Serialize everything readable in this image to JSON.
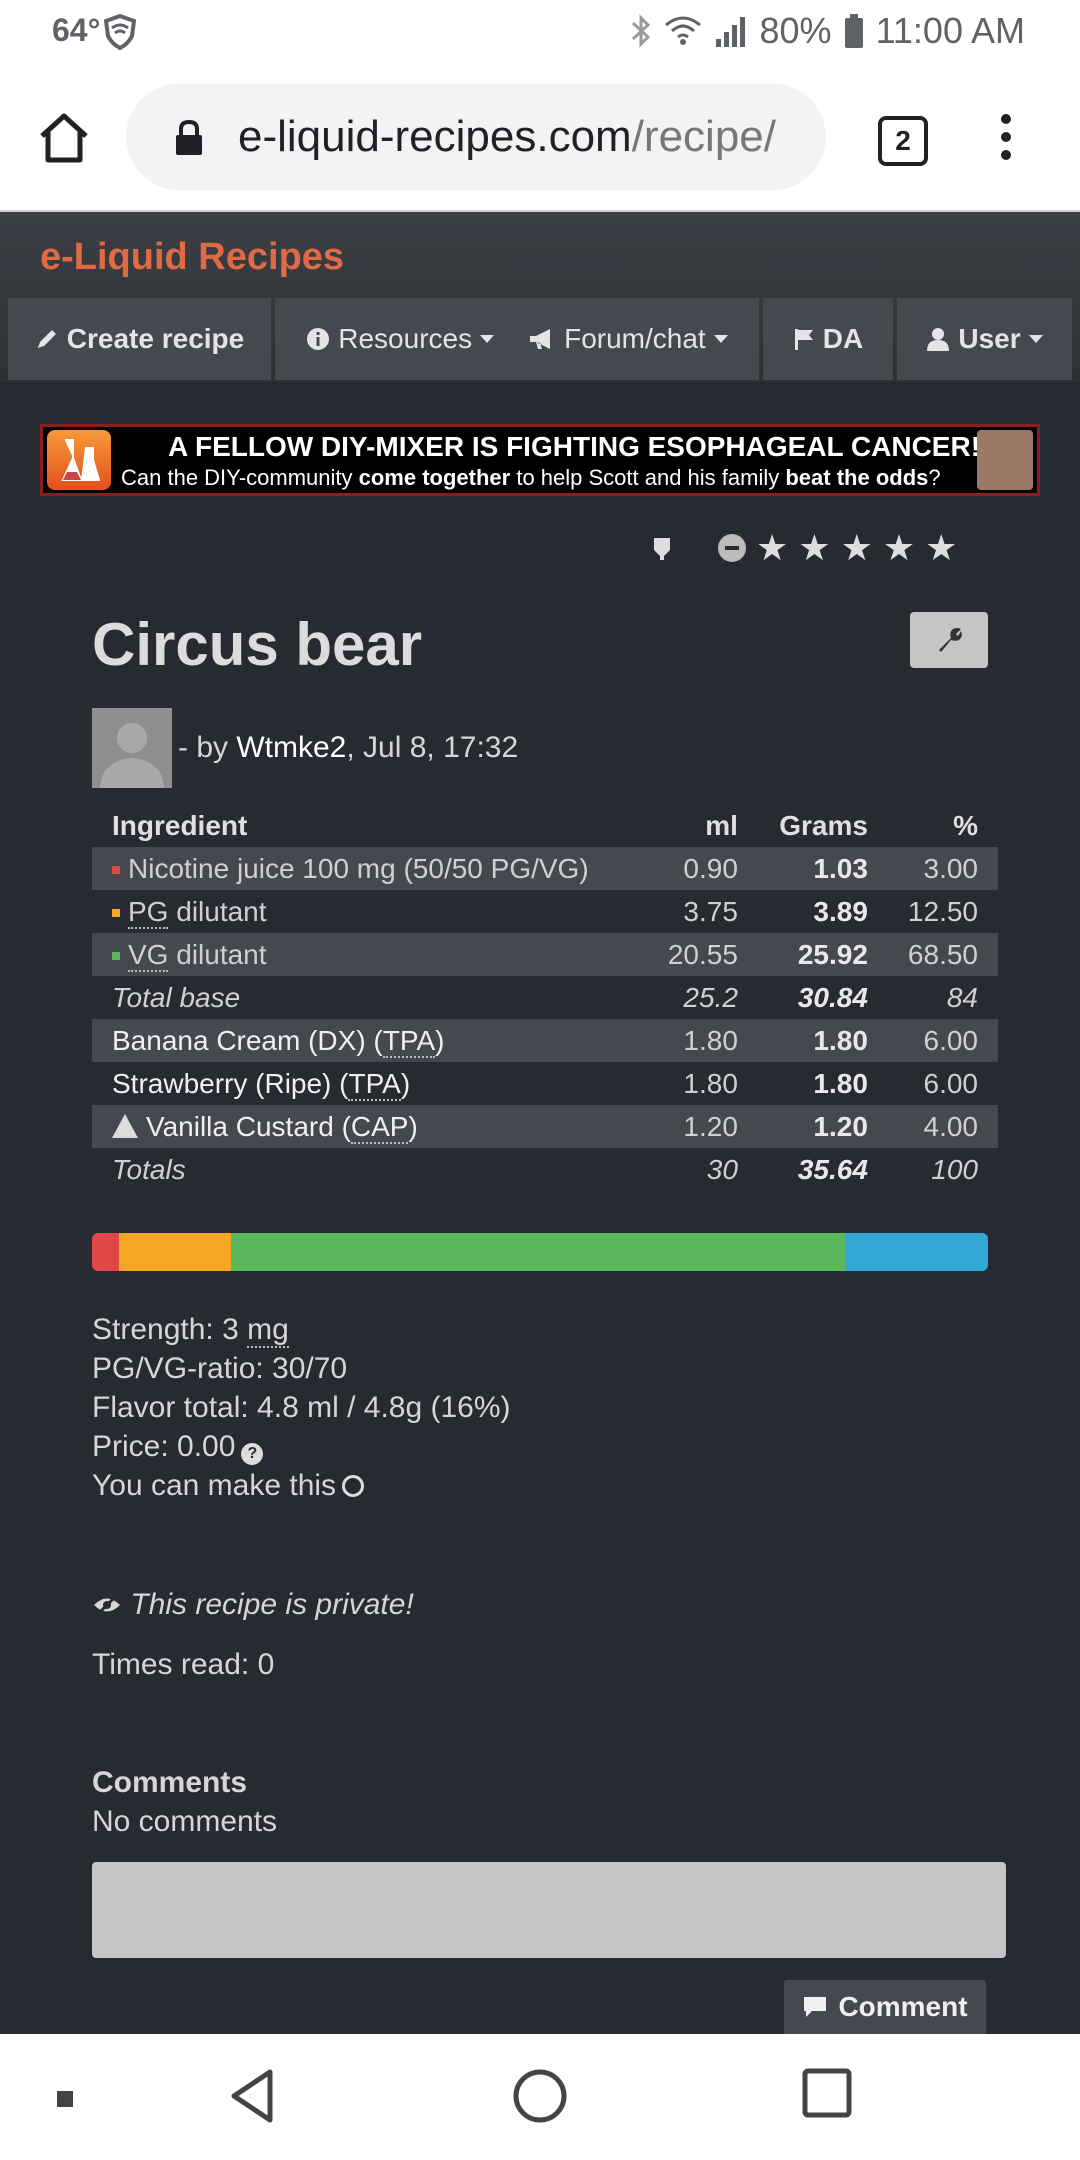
{
  "status_bar": {
    "temperature": "64°",
    "battery": "80%",
    "time": "11:00 AM"
  },
  "browser": {
    "url_domain": "e-liquid-recipes.com",
    "url_path": "/recipe/",
    "tab_count": "2"
  },
  "site": {
    "brand": "e-Liquid Recipes",
    "brand_color": "#e06a44"
  },
  "nav": {
    "create": "Create recipe",
    "resources": "Resources",
    "forum": "Forum/chat",
    "da": "DA",
    "user": "User"
  },
  "banner": {
    "headline": "A FELLOW DIY-MIXER IS FIGHTING ESOPHAGEAL CANCER!",
    "sub_1": "Can the DIY-community ",
    "sub_bold_1": "come together",
    "sub_2": " to help Scott and his family ",
    "sub_bold_2": "beat the odds",
    "sub_3": "?"
  },
  "rating": {
    "stars": 5,
    "filled": 0
  },
  "recipe": {
    "title": "Circus bear",
    "by_prefix": " - by ",
    "author": "Wtmke2",
    "date": ", Jul 8, 17:32"
  },
  "table": {
    "headers": {
      "ingredient": "Ingredient",
      "ml": "ml",
      "grams": "Grams",
      "pct": "%"
    },
    "rows": [
      {
        "name": "Nicotine juice 100 mg (50/50 PG/VG)",
        "ml": "0.90",
        "grams": "1.03",
        "pct": "3.00",
        "swatch": "#e04848"
      },
      {
        "pre": "PG",
        "name": " dilutant",
        "ml": "3.75",
        "grams": "3.89",
        "pct": "12.50",
        "swatch": "#f5a623"
      },
      {
        "pre": "VG",
        "name": " dilutant",
        "ml": "20.55",
        "grams": "25.92",
        "pct": "68.50",
        "swatch": "#5cb85c"
      },
      {
        "name": "Total base",
        "ml": "25.2",
        "grams": "30.84",
        "pct": "84"
      },
      {
        "name": "Banana Cream (DX) (",
        "abbr": "TPA",
        "post": ")",
        "ml": "1.80",
        "grams": "1.80",
        "pct": "6.00"
      },
      {
        "name": "Strawberry (Ripe) (",
        "abbr": "TPA",
        "post": ")",
        "ml": "1.80",
        "grams": "1.80",
        "pct": "6.00"
      },
      {
        "name": "Vanilla Custard (",
        "abbr": "CAP",
        "post": ")",
        "ml": "1.20",
        "grams": "1.20",
        "pct": "4.00"
      },
      {
        "name": "Totals",
        "ml": "30",
        "grams": "35.64",
        "pct": "100"
      }
    ]
  },
  "ratio_bar": {
    "segments": [
      {
        "label": "nicotine",
        "percent": 3,
        "color": "#e04848"
      },
      {
        "label": "pg",
        "percent": 12.5,
        "color": "#f5a623"
      },
      {
        "label": "vg",
        "percent": 68.5,
        "color": "#5cb85c"
      },
      {
        "label": "flavor",
        "percent": 16,
        "color": "#31a8d5"
      }
    ]
  },
  "info": {
    "strength_label": "Strength: 3 ",
    "strength_unit": "mg",
    "ratio": "PG/VG-ratio: 30/70",
    "flavor_total": "Flavor total: 4.8 ml / 4.8g (16%)",
    "price": "Price: 0.00",
    "make": "You can make this"
  },
  "private_note": "This recipe is private!",
  "times_read": "Times read: 0",
  "comments": {
    "heading": "Comments",
    "empty": "No comments",
    "button": "Comment"
  }
}
